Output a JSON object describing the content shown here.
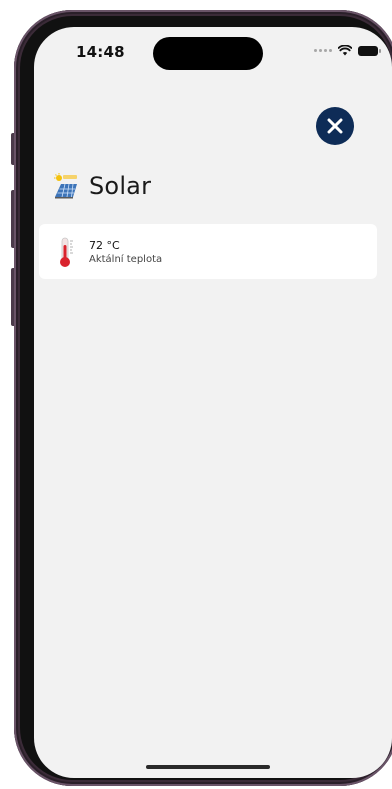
{
  "status_bar": {
    "time": "14:48",
    "icons": [
      "signal-dots-icon",
      "wifi-icon",
      "battery-icon"
    ]
  },
  "header": {
    "icon": "solar-panel-icon",
    "title": "Solar"
  },
  "close_button": {
    "icon": "close-icon",
    "color": "#0e2c57"
  },
  "sensors": [
    {
      "icon": "thermometer-icon",
      "value": "72 °C",
      "label": "Aktální teplota"
    }
  ],
  "colors": {
    "screen_background": "#f2f2f2",
    "card_background": "#ffffff",
    "accent": "#0e2c57",
    "frame": "#3b2b38"
  }
}
